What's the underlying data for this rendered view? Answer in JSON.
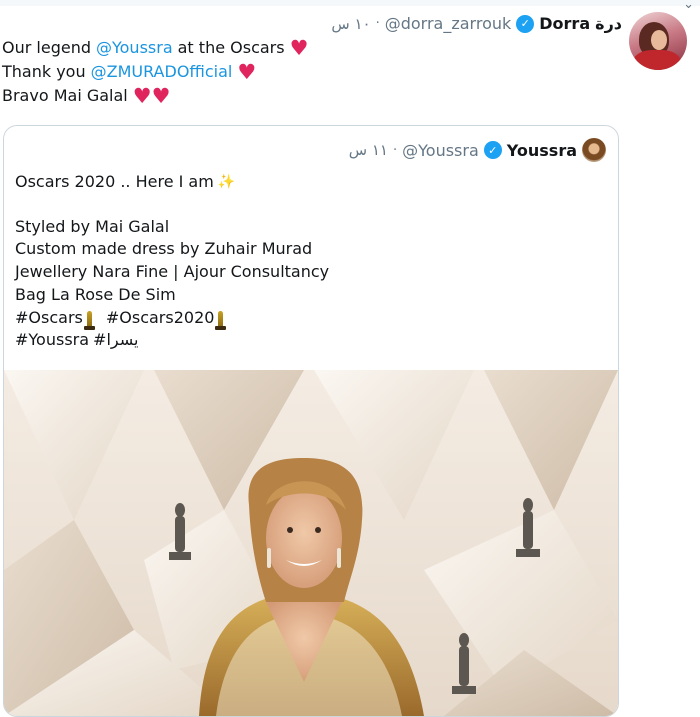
{
  "outer_tweet": {
    "name_ar": "درة",
    "name": "Dorra",
    "handle": "@dorra_zarrouk",
    "separator": "·",
    "time": "١٠ س",
    "lines": [
      {
        "parts": [
          {
            "text": "Our legend "
          },
          {
            "text": "@Youssra",
            "mention": true
          },
          {
            "text": " at the Oscars"
          }
        ],
        "hearts": 1
      },
      {
        "parts": [
          {
            "text": "Thank you "
          },
          {
            "text": "@ZMURADOfficial",
            "mention": true
          }
        ],
        "hearts": 1
      },
      {
        "parts": [
          {
            "text": "Bravo Mai Galal"
          }
        ],
        "hearts": 2
      }
    ]
  },
  "quoted_tweet": {
    "name": "Youssra",
    "handle": "@Youssra",
    "separator": "·",
    "time": "١١ س",
    "line1": "Oscars 2020 .. Here I am",
    "line3": "Styled by Mai Galal",
    "line4": "Custom made dress by Zuhair Murad",
    "line5": "Jewellery Nara Fine | Ajour Consultancy",
    "line6": "Bag La Rose De Sim",
    "hashtag_oscars": "#Oscars",
    "hashtag_oscars2020": "#Oscars2020",
    "hashtag_youssra": "#Youssra",
    "hashtag_arabic": "#يسرا"
  },
  "icons": {
    "verified": "verified-badge-icon",
    "heart": "red-heart-icon",
    "sparkle": "sparkle-star-icon",
    "oscar": "oscar-statuette-icon"
  },
  "colors": {
    "mention": "#1b95e0",
    "verified": "#1da1f2",
    "heart": "#e0245e",
    "muted": "#657786"
  }
}
